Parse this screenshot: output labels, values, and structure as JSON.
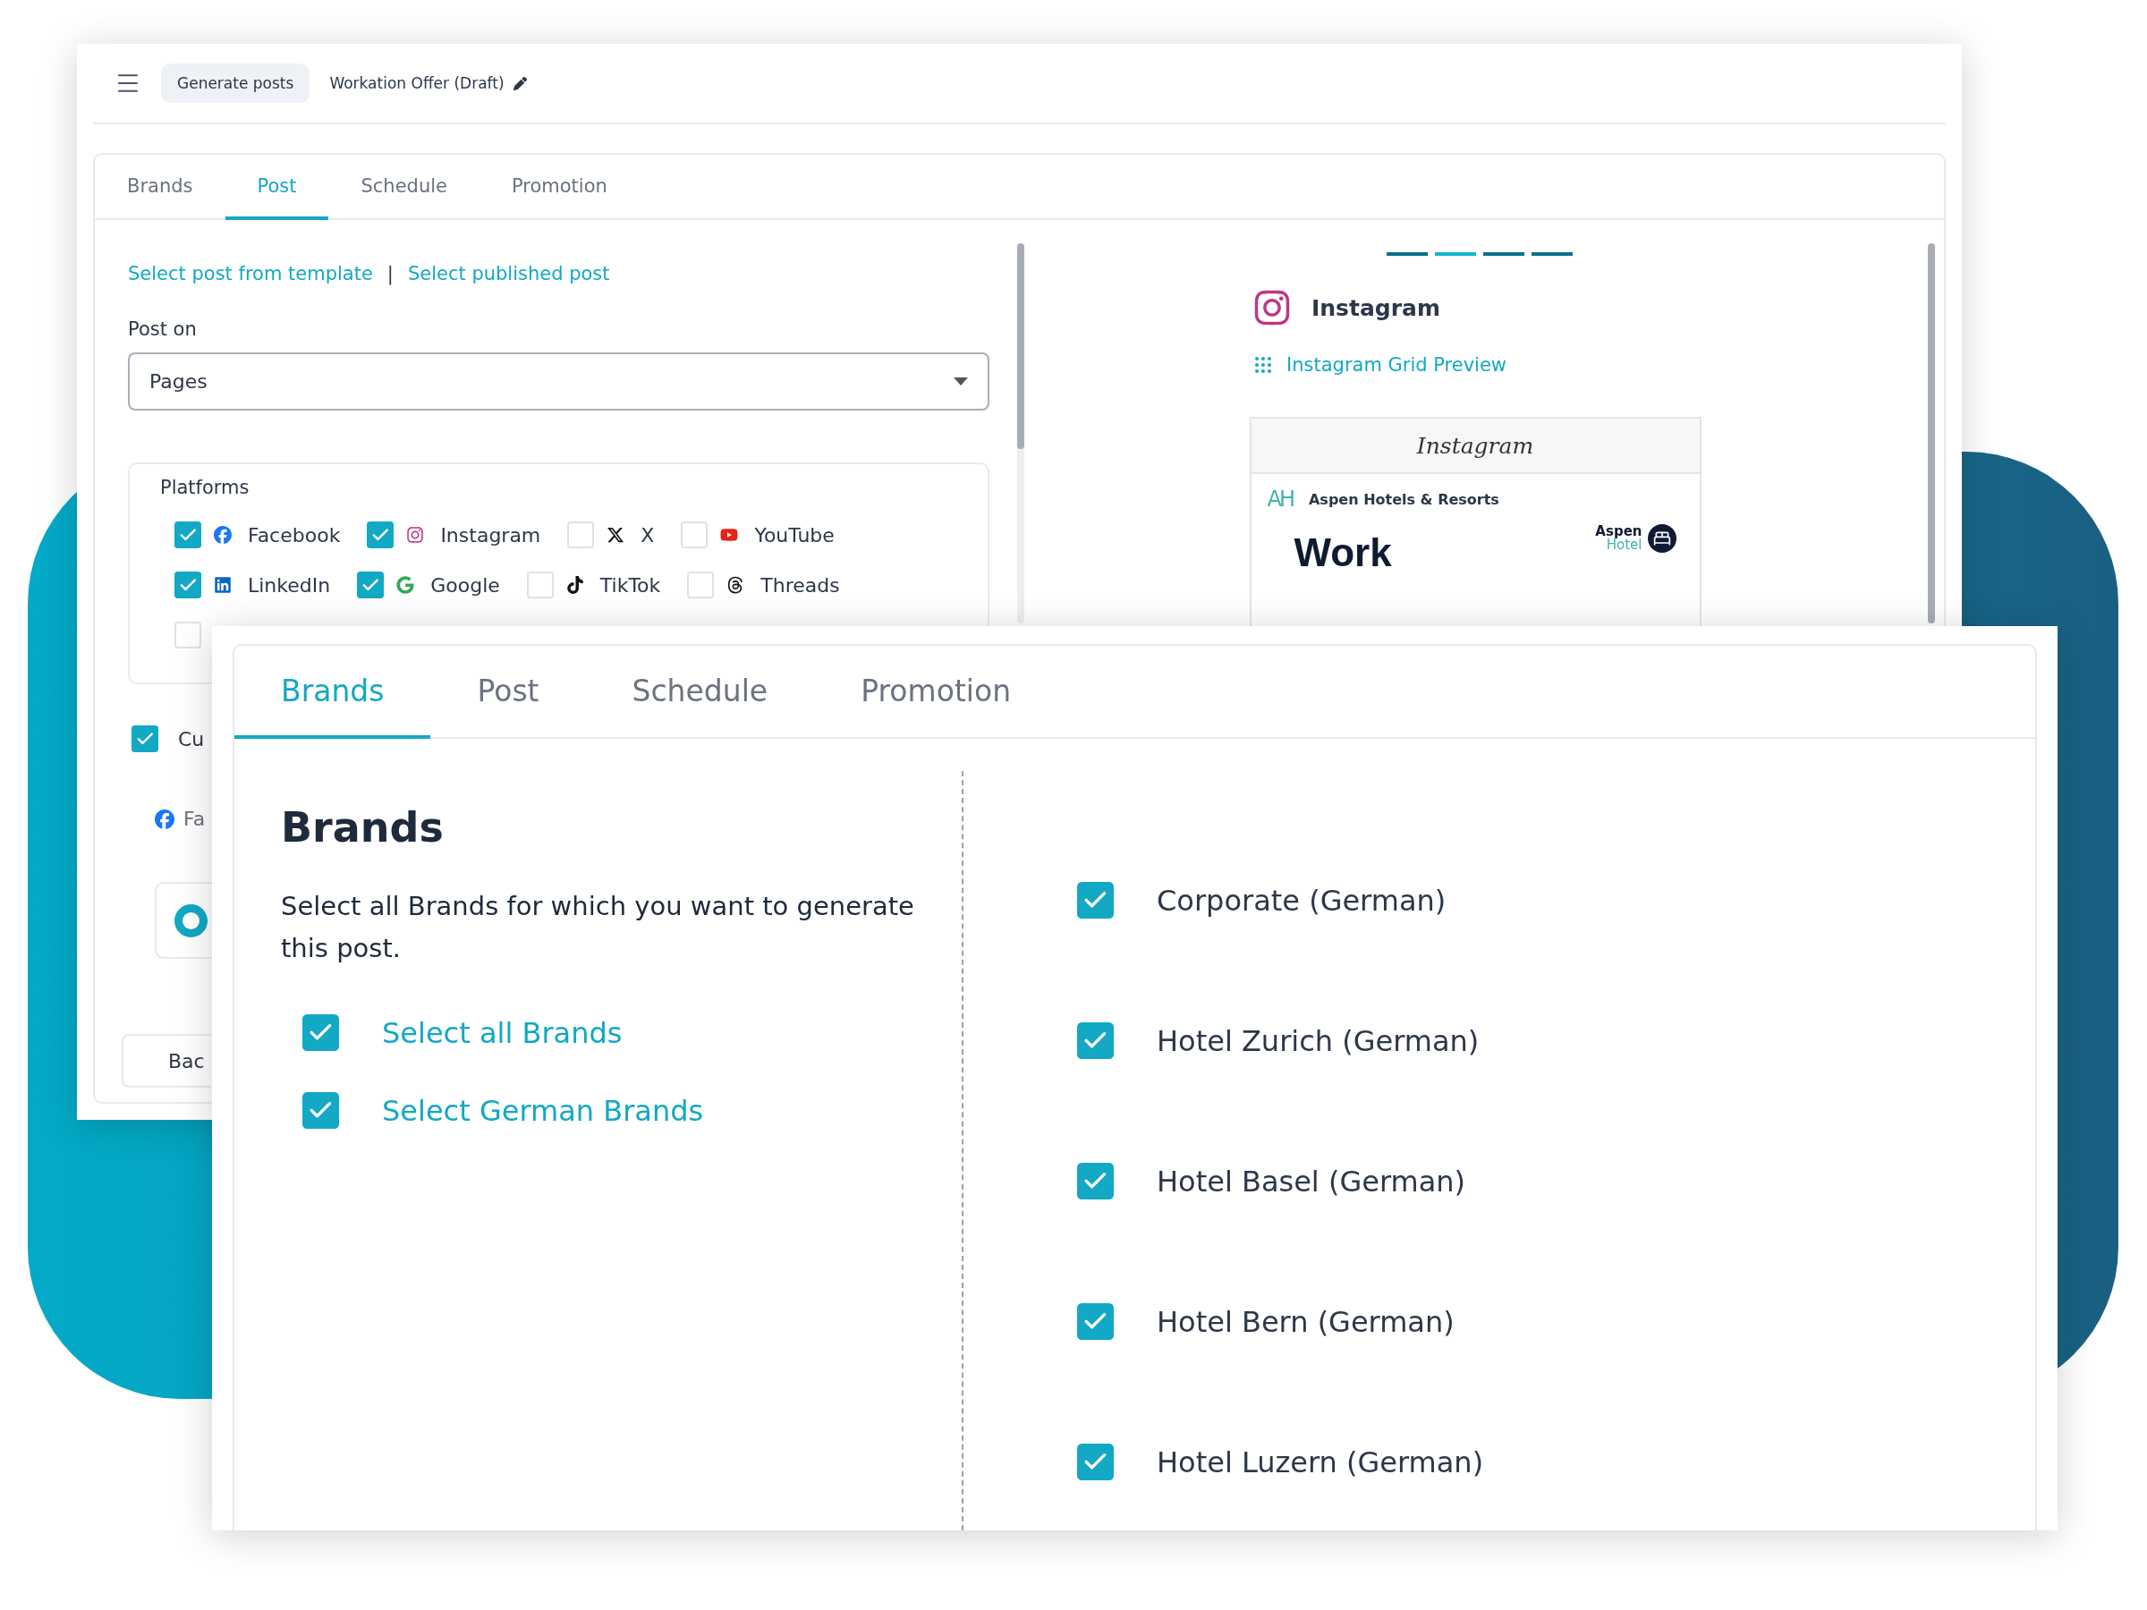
{
  "back_window": {
    "header": {
      "breadcrumb": "Generate posts",
      "title": "Workation Offer (Draft)"
    },
    "tabs": [
      {
        "label": "Brands",
        "selected": false
      },
      {
        "label": "Post",
        "selected": true
      },
      {
        "label": "Schedule",
        "selected": false
      },
      {
        "label": "Promotion",
        "selected": false
      }
    ],
    "links": {
      "template": "Select post from template",
      "separator": "|",
      "published": "Select published post"
    },
    "post_on": {
      "label": "Post on",
      "value": "Pages"
    },
    "platforms": {
      "title": "Platforms",
      "rows": [
        [
          {
            "kind": "facebook",
            "label": "Facebook",
            "checked": true
          },
          {
            "kind": "instagram",
            "label": "Instagram",
            "checked": true
          },
          {
            "kind": "x",
            "label": "X",
            "checked": false
          },
          {
            "kind": "youtube",
            "label": "YouTube",
            "checked": false
          }
        ],
        [
          {
            "kind": "linkedin",
            "label": "LinkedIn",
            "checked": true
          },
          {
            "kind": "google",
            "label": "Google",
            "checked": true
          },
          {
            "kind": "tiktok",
            "label": "TikTok",
            "checked": false
          },
          {
            "kind": "threads",
            "label": "Threads",
            "checked": false
          }
        ],
        [
          {
            "kind": "none",
            "checked": false
          }
        ]
      ]
    },
    "custom": {
      "label": "Cu",
      "checked": true
    },
    "account": {
      "label": "Fa"
    },
    "back_button": "Bac",
    "preview": {
      "pager": [
        {
          "selected": false
        },
        {
          "selected": true
        },
        {
          "selected": false
        },
        {
          "selected": false
        }
      ],
      "platform": "Instagram",
      "grid_link": "Instagram Grid Preview",
      "post": {
        "app_name": "Instagram",
        "logo": "AH",
        "account": "Aspen Hotels & Resorts",
        "headline": "Work",
        "brand_top": "Aspen",
        "brand_bottom": "Hotel"
      }
    }
  },
  "front_window": {
    "tabs": [
      {
        "label": "Brands",
        "selected": true
      },
      {
        "label": "Post",
        "selected": false
      },
      {
        "label": "Schedule",
        "selected": false
      },
      {
        "label": "Promotion",
        "selected": false
      }
    ],
    "title": "Brands",
    "description": "Select all Brands for which you want to generate this post.",
    "quick_select": [
      {
        "label": "Select all Brands",
        "checked": true
      },
      {
        "label": "Select German Brands",
        "checked": true
      }
    ],
    "brands": [
      {
        "label": "Corporate (German)",
        "checked": true
      },
      {
        "label": "Hotel Zurich (German)",
        "checked": true
      },
      {
        "label": "Hotel Basel (German)",
        "checked": true
      },
      {
        "label": "Hotel Bern (German)",
        "checked": true
      },
      {
        "label": "Hotel Luzern (German)",
        "checked": true
      }
    ]
  }
}
